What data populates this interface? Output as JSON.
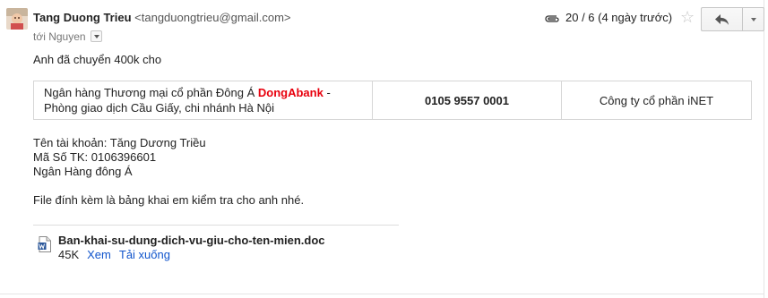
{
  "message": {
    "sender_name": "Tang Duong Trieu",
    "sender_email": "<tangduongtrieu@gmail.com>",
    "recipient": "tới Nguyen",
    "date": "20 / 6 (4 ngày trước)",
    "greeting": "Anh đã chuyển 400k cho",
    "bank_row": {
      "bank_prefix": "Ngân hàng Thương mại cổ phần Đông Á ",
      "bank_brand": "DongAbank",
      "bank_suffix": " - Phòng giao dịch Cầu Giấy, chi nhánh Hà Nội",
      "account_number": "0105 9557 0001",
      "company": "Công ty cổ phần iNET"
    },
    "account_name": "Tên tài khoản: Tăng Dương Triều",
    "account_id": "Mã Số TK: 0106396601",
    "bank_short": "Ngân Hàng đông Á",
    "closing": "File đính kèm là bảng khai em kiểm tra cho anh nhé."
  },
  "attachment": {
    "filename": "Ban-khai-su-dung-dich-vu-giu-cho-ten-mien.doc",
    "size": "45K",
    "view_label": "Xem",
    "download_label": "Tải xuống"
  },
  "icons": {
    "avatar": "avatar-photo",
    "attachment": "paperclip-icon",
    "star": "star-icon",
    "reply": "reply-arrow-icon",
    "more": "chevron-down-icon",
    "file": "word-doc-icon"
  },
  "colors": {
    "link": "#1155cc",
    "brand": "#e8000d",
    "border": "#d6d6d6"
  }
}
